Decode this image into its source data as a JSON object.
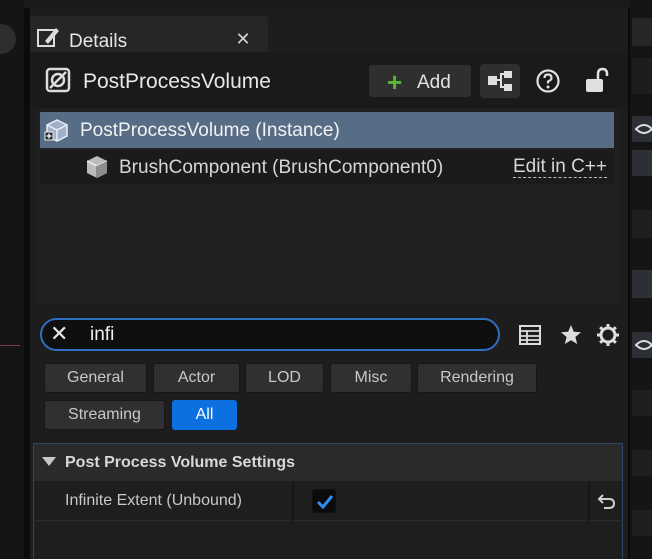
{
  "tab": {
    "title": "Details",
    "close_glyph": "✕",
    "icon": "details-pencil-icon"
  },
  "header": {
    "actor_name": "PostProcessVolume",
    "add_label": "Add",
    "add_glyph": "+",
    "icons": [
      "actor-icon",
      "plus-icon",
      "blueprint-icon",
      "help-icon",
      "lock-icon"
    ]
  },
  "components": [
    {
      "label": "PostProcessVolume (Instance)",
      "selected": true,
      "icon": "cube-icon"
    },
    {
      "label": "BrushComponent (BrushComponent0)",
      "selected": false,
      "icon": "cube-icon",
      "action": "Edit in C++"
    }
  ],
  "search": {
    "value": "infi",
    "clear_glyph": "✕"
  },
  "toolbar_icons": [
    "table-view-icon",
    "star-icon",
    "gear-icon"
  ],
  "filters": [
    {
      "label": "General",
      "active": false
    },
    {
      "label": "Actor",
      "active": false
    },
    {
      "label": "LOD",
      "active": false
    },
    {
      "label": "Misc",
      "active": false
    },
    {
      "label": "Rendering",
      "active": false
    },
    {
      "label": "Streaming",
      "active": false
    },
    {
      "label": "All",
      "active": true
    }
  ],
  "category": {
    "label": "Post Process Volume Settings"
  },
  "property": {
    "name": "Infinite Extent (Unbound)",
    "checked": true
  },
  "colors": {
    "accent": "#0d70e0",
    "selection": "#576c85",
    "add_green": "#5ab534",
    "panel_bg": "#1d1d1d"
  }
}
